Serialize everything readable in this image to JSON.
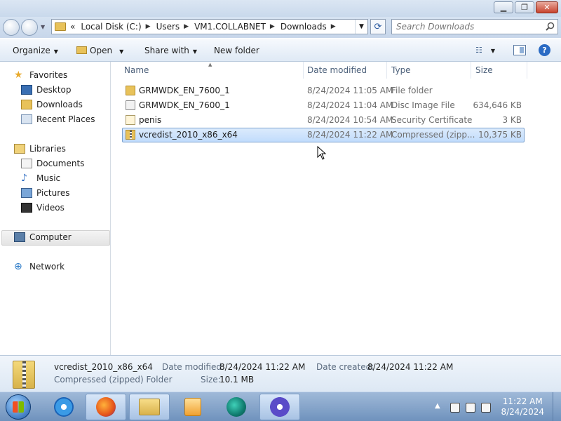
{
  "window": {
    "minimize_glyph": "▁",
    "maximize_glyph": "❐",
    "close_glyph": "✕"
  },
  "navigation": {
    "history_glyph": "▼",
    "breadcrumb_prefix": "«",
    "breadcrumbs": [
      "Local Disk (C:)",
      "Users",
      "VM1.COLLABNET",
      "Downloads"
    ],
    "refresh_glyph": "⟳",
    "search_placeholder": "Search Downloads"
  },
  "commandbar": {
    "organize": "Organize",
    "open": "Open",
    "share_with": "Share with",
    "new_folder": "New folder",
    "help_glyph": "?"
  },
  "navpane": {
    "favorites": "Favorites",
    "desktop": "Desktop",
    "downloads": "Downloads",
    "recent_places": "Recent Places",
    "libraries": "Libraries",
    "documents": "Documents",
    "music": "Music",
    "pictures": "Pictures",
    "videos": "Videos",
    "computer": "Computer",
    "network": "Network",
    "star_glyph": "★",
    "music_glyph": "♪",
    "network_glyph": "⊕"
  },
  "columns": {
    "name": "Name",
    "date_modified": "Date modified",
    "type": "Type",
    "size": "Size"
  },
  "files": [
    {
      "name": "GRMWDK_EN_7600_1",
      "date": "8/24/2024 11:05 AM",
      "type": "File folder",
      "size": "",
      "icon": "folder-icon"
    },
    {
      "name": "GRMWDK_EN_7600_1",
      "date": "8/24/2024 11:04 AM",
      "type": "Disc Image File",
      "size": "634,646 KB",
      "icon": "disc-image-icon"
    },
    {
      "name": "penis",
      "date": "8/24/2024 10:54 AM",
      "type": "Security Certificate",
      "size": "3 KB",
      "icon": "certificate-icon"
    },
    {
      "name": "vcredist_2010_x86_x64",
      "date": "8/24/2024 11:22 AM",
      "type": "Compressed (zipp...",
      "size": "10,375 KB",
      "icon": "zip-folder-icon",
      "selected": true
    }
  ],
  "details": {
    "name": "vcredist_2010_x86_x64",
    "type": "Compressed (zipped) Folder",
    "date_modified_label": "Date modified:",
    "date_modified": "8/24/2024 11:22 AM",
    "date_created_label": "Date created:",
    "date_created": "8/24/2024 11:22 AM",
    "size_label": "Size:",
    "size": "10.1 MB"
  },
  "taskbar": {
    "tray_arrow": "▲",
    "time": "11:22 AM",
    "date": "8/24/2024"
  }
}
